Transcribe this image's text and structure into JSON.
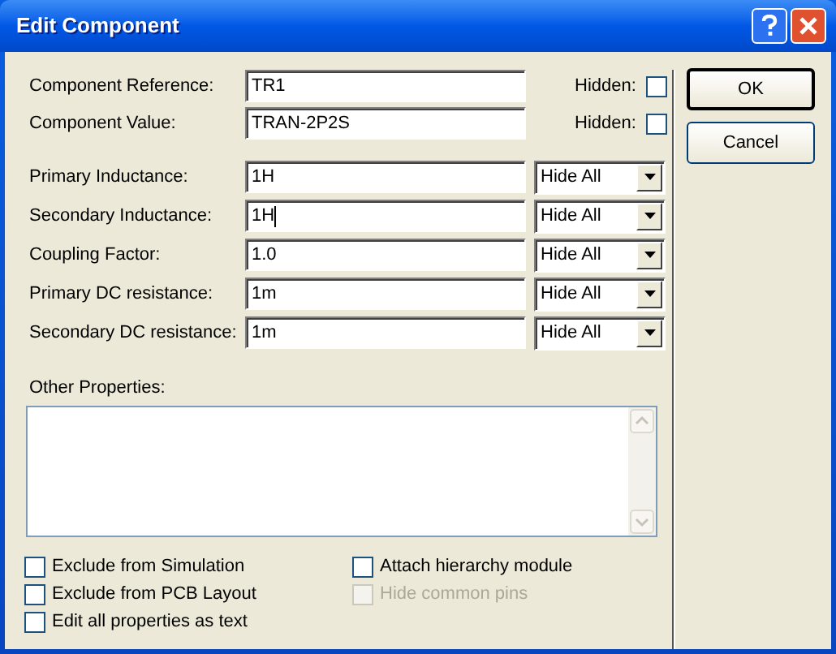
{
  "window": {
    "title": "Edit Component"
  },
  "fields": [
    {
      "label": "Component Reference:",
      "value": "TR1",
      "hidden_label": "Hidden:",
      "hidden": false
    },
    {
      "label": "Component Value:",
      "value": "TRAN-2P2S",
      "hidden_label": "Hidden:",
      "hidden": false
    }
  ],
  "properties": [
    {
      "label": "Primary Inductance:",
      "value": "1H",
      "visibility": "Hide All",
      "focused": false
    },
    {
      "label": "Secondary Inductance:",
      "value": "1H",
      "visibility": "Hide All",
      "focused": true
    },
    {
      "label": "Coupling Factor:",
      "value": "1.0",
      "visibility": "Hide All",
      "focused": false
    },
    {
      "label": "Primary DC resistance:",
      "value": "1m",
      "visibility": "Hide All",
      "focused": false
    },
    {
      "label": "Secondary DC resistance:",
      "value": "1m",
      "visibility": "Hide All",
      "focused": false
    }
  ],
  "other_properties": {
    "label": "Other Properties:"
  },
  "options": [
    {
      "label": "Exclude from Simulation",
      "checked": false,
      "disabled": false
    },
    {
      "label": "Attach hierarchy module",
      "checked": false,
      "disabled": false
    },
    {
      "label": "Exclude from PCB Layout",
      "checked": false,
      "disabled": false
    },
    {
      "label": "Hide common pins",
      "checked": false,
      "disabled": true
    },
    {
      "label": "Edit all properties as text",
      "checked": false,
      "disabled": false
    }
  ],
  "buttons": [
    {
      "label": "OK",
      "default": true
    },
    {
      "label": "Cancel",
      "default": false
    }
  ]
}
